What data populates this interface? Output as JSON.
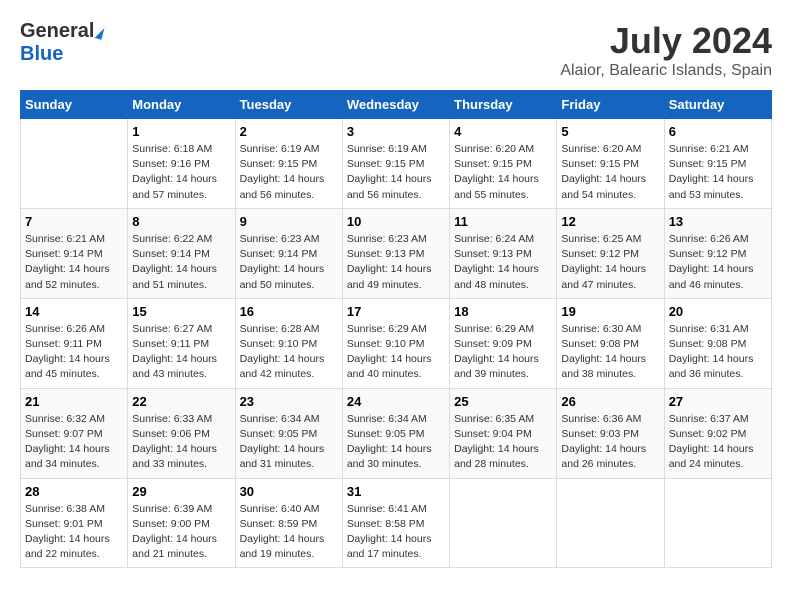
{
  "logo": {
    "general": "General",
    "blue": "Blue"
  },
  "title": {
    "month_year": "July 2024",
    "location": "Alaior, Balearic Islands, Spain"
  },
  "calendar": {
    "headers": [
      "Sunday",
      "Monday",
      "Tuesday",
      "Wednesday",
      "Thursday",
      "Friday",
      "Saturday"
    ],
    "rows": [
      [
        {
          "day": "",
          "info": ""
        },
        {
          "day": "1",
          "info": "Sunrise: 6:18 AM\nSunset: 9:16 PM\nDaylight: 14 hours\nand 57 minutes."
        },
        {
          "day": "2",
          "info": "Sunrise: 6:19 AM\nSunset: 9:15 PM\nDaylight: 14 hours\nand 56 minutes."
        },
        {
          "day": "3",
          "info": "Sunrise: 6:19 AM\nSunset: 9:15 PM\nDaylight: 14 hours\nand 56 minutes."
        },
        {
          "day": "4",
          "info": "Sunrise: 6:20 AM\nSunset: 9:15 PM\nDaylight: 14 hours\nand 55 minutes."
        },
        {
          "day": "5",
          "info": "Sunrise: 6:20 AM\nSunset: 9:15 PM\nDaylight: 14 hours\nand 54 minutes."
        },
        {
          "day": "6",
          "info": "Sunrise: 6:21 AM\nSunset: 9:15 PM\nDaylight: 14 hours\nand 53 minutes."
        }
      ],
      [
        {
          "day": "7",
          "info": "Sunrise: 6:21 AM\nSunset: 9:14 PM\nDaylight: 14 hours\nand 52 minutes."
        },
        {
          "day": "8",
          "info": "Sunrise: 6:22 AM\nSunset: 9:14 PM\nDaylight: 14 hours\nand 51 minutes."
        },
        {
          "day": "9",
          "info": "Sunrise: 6:23 AM\nSunset: 9:14 PM\nDaylight: 14 hours\nand 50 minutes."
        },
        {
          "day": "10",
          "info": "Sunrise: 6:23 AM\nSunset: 9:13 PM\nDaylight: 14 hours\nand 49 minutes."
        },
        {
          "day": "11",
          "info": "Sunrise: 6:24 AM\nSunset: 9:13 PM\nDaylight: 14 hours\nand 48 minutes."
        },
        {
          "day": "12",
          "info": "Sunrise: 6:25 AM\nSunset: 9:12 PM\nDaylight: 14 hours\nand 47 minutes."
        },
        {
          "day": "13",
          "info": "Sunrise: 6:26 AM\nSunset: 9:12 PM\nDaylight: 14 hours\nand 46 minutes."
        }
      ],
      [
        {
          "day": "14",
          "info": "Sunrise: 6:26 AM\nSunset: 9:11 PM\nDaylight: 14 hours\nand 45 minutes."
        },
        {
          "day": "15",
          "info": "Sunrise: 6:27 AM\nSunset: 9:11 PM\nDaylight: 14 hours\nand 43 minutes."
        },
        {
          "day": "16",
          "info": "Sunrise: 6:28 AM\nSunset: 9:10 PM\nDaylight: 14 hours\nand 42 minutes."
        },
        {
          "day": "17",
          "info": "Sunrise: 6:29 AM\nSunset: 9:10 PM\nDaylight: 14 hours\nand 40 minutes."
        },
        {
          "day": "18",
          "info": "Sunrise: 6:29 AM\nSunset: 9:09 PM\nDaylight: 14 hours\nand 39 minutes."
        },
        {
          "day": "19",
          "info": "Sunrise: 6:30 AM\nSunset: 9:08 PM\nDaylight: 14 hours\nand 38 minutes."
        },
        {
          "day": "20",
          "info": "Sunrise: 6:31 AM\nSunset: 9:08 PM\nDaylight: 14 hours\nand 36 minutes."
        }
      ],
      [
        {
          "day": "21",
          "info": "Sunrise: 6:32 AM\nSunset: 9:07 PM\nDaylight: 14 hours\nand 34 minutes."
        },
        {
          "day": "22",
          "info": "Sunrise: 6:33 AM\nSunset: 9:06 PM\nDaylight: 14 hours\nand 33 minutes."
        },
        {
          "day": "23",
          "info": "Sunrise: 6:34 AM\nSunset: 9:05 PM\nDaylight: 14 hours\nand 31 minutes."
        },
        {
          "day": "24",
          "info": "Sunrise: 6:34 AM\nSunset: 9:05 PM\nDaylight: 14 hours\nand 30 minutes."
        },
        {
          "day": "25",
          "info": "Sunrise: 6:35 AM\nSunset: 9:04 PM\nDaylight: 14 hours\nand 28 minutes."
        },
        {
          "day": "26",
          "info": "Sunrise: 6:36 AM\nSunset: 9:03 PM\nDaylight: 14 hours\nand 26 minutes."
        },
        {
          "day": "27",
          "info": "Sunrise: 6:37 AM\nSunset: 9:02 PM\nDaylight: 14 hours\nand 24 minutes."
        }
      ],
      [
        {
          "day": "28",
          "info": "Sunrise: 6:38 AM\nSunset: 9:01 PM\nDaylight: 14 hours\nand 22 minutes."
        },
        {
          "day": "29",
          "info": "Sunrise: 6:39 AM\nSunset: 9:00 PM\nDaylight: 14 hours\nand 21 minutes."
        },
        {
          "day": "30",
          "info": "Sunrise: 6:40 AM\nSunset: 8:59 PM\nDaylight: 14 hours\nand 19 minutes."
        },
        {
          "day": "31",
          "info": "Sunrise: 6:41 AM\nSunset: 8:58 PM\nDaylight: 14 hours\nand 17 minutes."
        },
        {
          "day": "",
          "info": ""
        },
        {
          "day": "",
          "info": ""
        },
        {
          "day": "",
          "info": ""
        }
      ]
    ]
  }
}
